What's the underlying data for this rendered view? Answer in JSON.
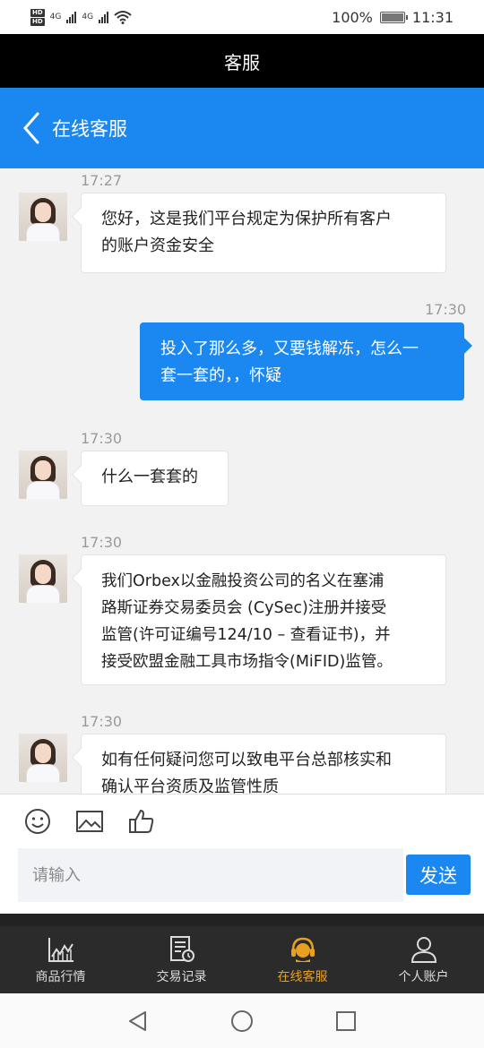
{
  "status_bar": {
    "battery": "100%",
    "time": "11:31",
    "network_left": "4G",
    "network_right": "4G",
    "hd_label": "HD"
  },
  "title_bar": {
    "title": "客服"
  },
  "nav": {
    "title": "在线客服"
  },
  "messages": [
    {
      "side": "left",
      "time": "17:27",
      "lines": [
        "您好，这是我们平台规定为保护所有客户",
        "的账户资金安全"
      ]
    },
    {
      "side": "right",
      "time": "17:30",
      "lines": [
        "投入了那么多，又要钱解冻，怎么一",
        "套一套的，，怀疑"
      ]
    },
    {
      "side": "left",
      "time": "17:30",
      "lines": [
        "什么一套套的"
      ]
    },
    {
      "side": "left",
      "time": "17:30",
      "lines": [
        "我们Orbex以金融投资公司的名义在塞浦",
        "路斯证券交易委员会 (CySec)注册并接受",
        "监管(许可证编号124/10 – 查看证书)，并",
        "接受欧盟金融工具市场指令(MiFID)监管。"
      ]
    },
    {
      "side": "left",
      "time": "17:30",
      "lines": [
        "如有任何疑问您可以致电平台总部核实和",
        "确认平台资质及监管性质"
      ]
    }
  ],
  "input": {
    "placeholder": "请输入",
    "value": ""
  },
  "send_label": "发送",
  "tabs": [
    {
      "label": "商品行情",
      "icon": "chart-icon",
      "active": false
    },
    {
      "label": "交易记录",
      "icon": "records-icon",
      "active": false
    },
    {
      "label": "在线客服",
      "icon": "headset-icon",
      "active": true
    },
    {
      "label": "个人账户",
      "icon": "user-icon",
      "active": false
    }
  ],
  "colors": {
    "accent": "#1b87f1",
    "active_tab": "#e8a020",
    "title_bar": "#000000"
  }
}
